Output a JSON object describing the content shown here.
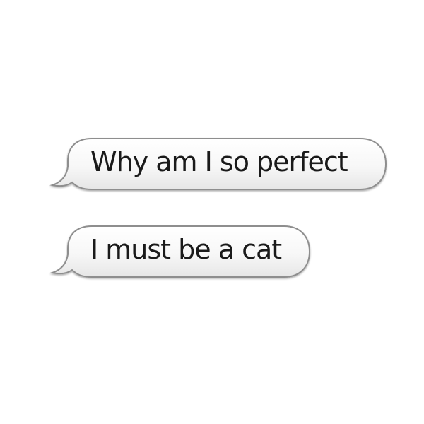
{
  "conversation": {
    "messages": [
      {
        "text": "Why am I so perfect"
      },
      {
        "text": "I must be a cat"
      }
    ]
  },
  "colors": {
    "background": "#ffffff",
    "bubble_fill_top": "#ffffff",
    "bubble_fill_bottom": "#e9e9e9",
    "bubble_border": "#8e8e8e",
    "text": "#1a1a1a"
  }
}
